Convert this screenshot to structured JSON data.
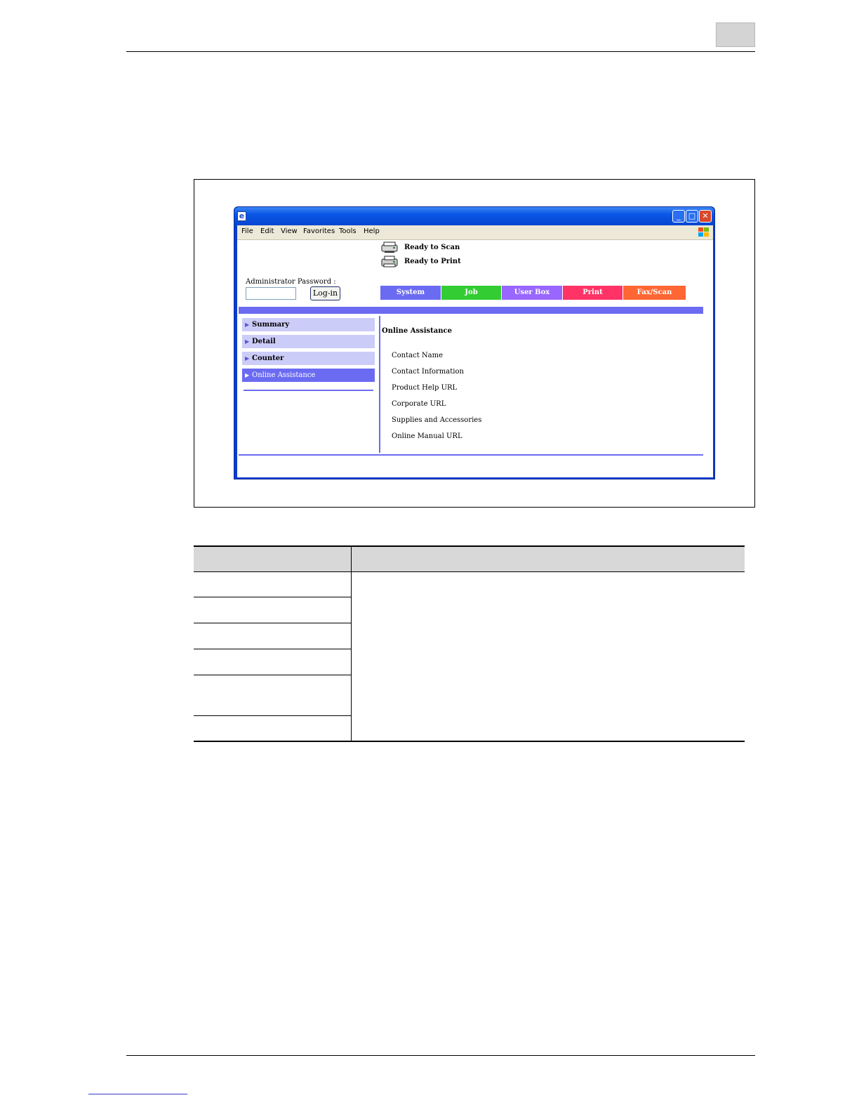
{
  "browser": {
    "menu": [
      "File",
      "Edit",
      "View",
      "Favorites",
      "Tools",
      "Help"
    ]
  },
  "status": {
    "scan": "Ready to Scan",
    "print": "Ready to Print"
  },
  "login": {
    "label": "Administrator Password :",
    "button": "Log-in"
  },
  "tabs": [
    {
      "label": "System",
      "color": "#6b6bf2"
    },
    {
      "label": "Job",
      "color": "#33cc33"
    },
    {
      "label": "User Box",
      "color": "#9966ff"
    },
    {
      "label": "Print",
      "color": "#ff3366"
    },
    {
      "label": "Fax/Scan",
      "color": "#ff6633"
    }
  ],
  "sidebar": {
    "items": [
      {
        "label": "Summary"
      },
      {
        "label": "Detail"
      },
      {
        "label": "Counter"
      },
      {
        "label": "Online Assistance"
      }
    ]
  },
  "main": {
    "title": "Online Assistance",
    "items": [
      "Contact Name",
      "Contact Information",
      "Product Help URL",
      "Corporate URL",
      "Supplies and Accessories",
      "Online Manual URL"
    ]
  },
  "colors": {
    "accent": "#6b6bf2",
    "sidebar_inactive": "#ccccf8"
  }
}
